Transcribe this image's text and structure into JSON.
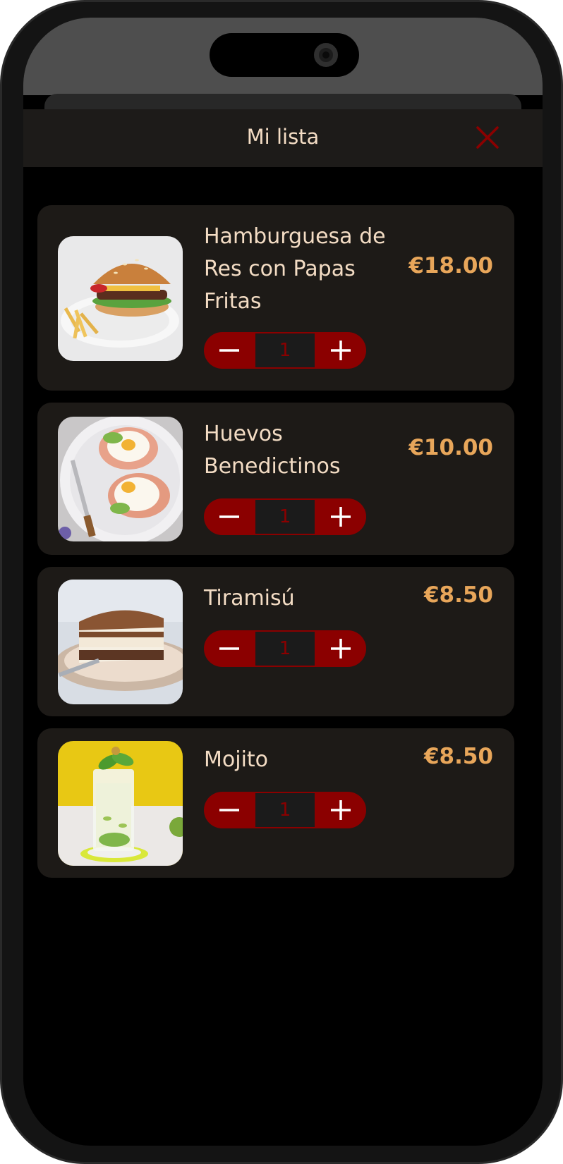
{
  "header": {
    "title": "Mi lista",
    "close_icon": "close-icon"
  },
  "colors": {
    "accent": "#8b0000",
    "price": "#e8a65a",
    "text": "#f3dcc4",
    "card": "#1d1a17"
  },
  "items": [
    {
      "name": "Hamburguesa de Res con Papas Fritas",
      "price": "€18.00",
      "quantity": "1",
      "image": "burger-with-fries"
    },
    {
      "name": "Huevos Benedictinos",
      "price": "€10.00",
      "quantity": "1",
      "image": "eggs-benedict"
    },
    {
      "name": "Tiramisú",
      "price": "€8.50",
      "quantity": "1",
      "image": "tiramisu"
    },
    {
      "name": "Mojito",
      "price": "€8.50",
      "quantity": "1",
      "image": "mojito"
    }
  ]
}
